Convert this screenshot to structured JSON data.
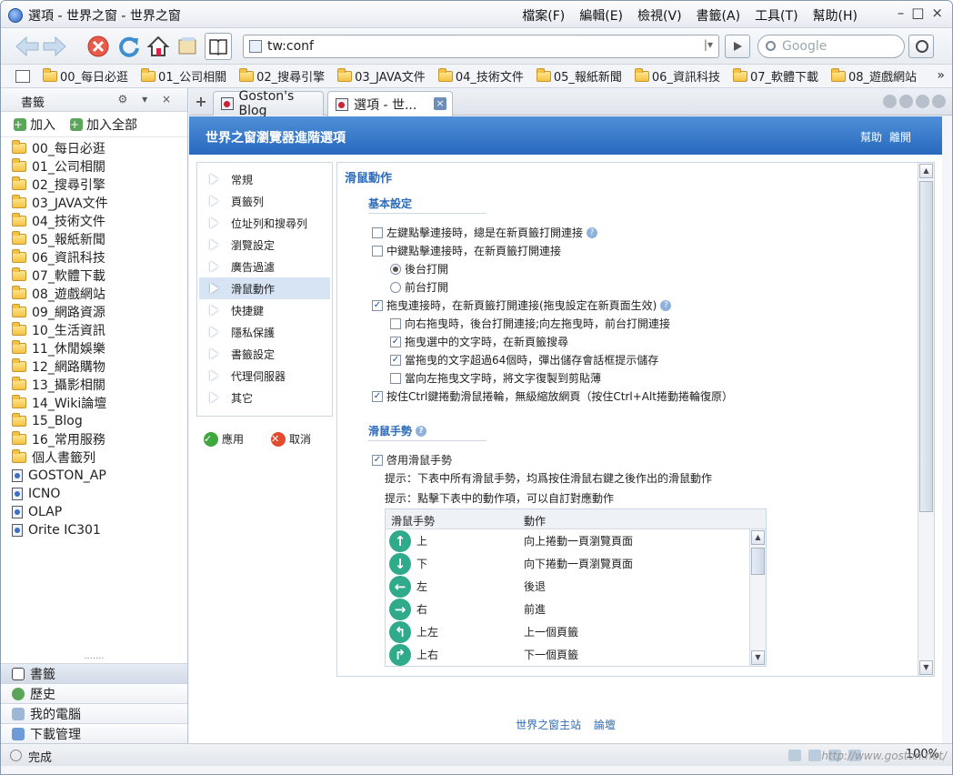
{
  "window": {
    "title": "選項 - 世界之窗 - 世界之窗"
  },
  "menu": [
    "檔案(F)",
    "編輯(E)",
    "檢視(V)",
    "書籤(A)",
    "工具(T)",
    "幫助(H)"
  ],
  "window_controls": [
    "–",
    "□",
    "×"
  ],
  "address": {
    "value": "tw:conf"
  },
  "search": {
    "placeholder": "Google"
  },
  "bookmarks_bar": [
    "00_每日必逛",
    "01_公司相關",
    "02_搜尋引擎",
    "03_JAVA文件",
    "04_技術文件",
    "05_報紙新聞",
    "06_資訊科技",
    "07_軟體下載",
    "08_遊戲網站"
  ],
  "bookmarks_more": "»",
  "sidebar": {
    "title": "書籤",
    "controls": "⚙ ▾ ×",
    "add": "加入",
    "add_all": "加入全部",
    "folders": [
      "00_每日必逛",
      "01_公司相關",
      "02_搜尋引擎",
      "03_JAVA文件",
      "04_技術文件",
      "05_報紙新聞",
      "06_資訊科技",
      "07_軟體下載",
      "08_遊戲網站",
      "09_網路資源",
      "10_生活資訊",
      "11_休閒娛樂",
      "12_網路購物",
      "13_攝影相關",
      "14_Wiki論壇",
      "15_Blog",
      "16_常用服務",
      "個人書籤列"
    ],
    "pages": [
      "GOSTON_AP",
      "ICNO",
      "OLAP",
      "Orite IC301"
    ],
    "bottom_tabs": [
      "書籤",
      "歷史",
      "我的電腦",
      "下載管理"
    ]
  },
  "tabs": [
    {
      "label": "Goston's Blog"
    },
    {
      "label": "選項 - 世..."
    }
  ],
  "page": {
    "banner_title": "世界之窗瀏覽器進階選項",
    "help": "幫助",
    "leave": "離開",
    "nav": [
      "常規",
      "頁籤列",
      "位址列和搜尋列",
      "瀏覽設定",
      "廣告過濾",
      "滑鼠動作",
      "快捷鍵",
      "隱私保護",
      "書籤設定",
      "代理伺服器",
      "其它"
    ],
    "apply": "應用",
    "cancel": "取消",
    "panel_title": "滑鼠動作",
    "basic_title": "基本設定",
    "opt1": "左鍵點擊連接時，總是在新頁籤打開連接",
    "opt2": "中鍵點擊連接時，在新頁籤打開連接",
    "radio_bg": "後台打開",
    "radio_fg": "前台打開",
    "opt3": "拖曳連接時，在新頁籤打開連接(拖曳設定在新頁面生效)",
    "opt3a": "向右拖曳時，後台打開連接;向左拖曳時，前台打開連接",
    "opt3b": "拖曳選中的文字時，在新頁籤搜尋",
    "opt3c": "當拖曳的文字超過64個時，彈出儲存會話框提示儲存",
    "opt3d": "當向左拖曳文字時，將文字復製到剪貼薄",
    "opt4": "按住Ctrl鍵捲動滑鼠捲輪，無級縮放網頁（按住Ctrl+Alt捲動捲輪復原）",
    "gesture_title": "滑鼠手勢",
    "gesture_enable": "啓用滑鼠手勢",
    "hint1": "提示：下表中所有滑鼠手勢，均爲按住滑鼠右鍵之後作出的滑鼠動作",
    "hint2": "提示：點擊下表中的動作項，可以自訂對應動作",
    "col_gesture": "滑鼠手勢",
    "col_action": "動作",
    "gestures": [
      {
        "icon": "↑",
        "name": "上",
        "action": "向上捲動一頁瀏覽頁面"
      },
      {
        "icon": "↓",
        "name": "下",
        "action": "向下捲動一頁瀏覽頁面"
      },
      {
        "icon": "←",
        "name": "左",
        "action": "後退"
      },
      {
        "icon": "→",
        "name": "右",
        "action": "前進"
      },
      {
        "icon": "↰",
        "name": "上左",
        "action": "上一個頁籤"
      },
      {
        "icon": "↱",
        "name": "上右",
        "action": "下一個頁籤"
      }
    ],
    "footer_site": "世界之窗主站",
    "footer_forum": "論壇"
  },
  "status": {
    "text": "完成",
    "zoom": "100%"
  },
  "watermark": "http://www.goston.net/"
}
